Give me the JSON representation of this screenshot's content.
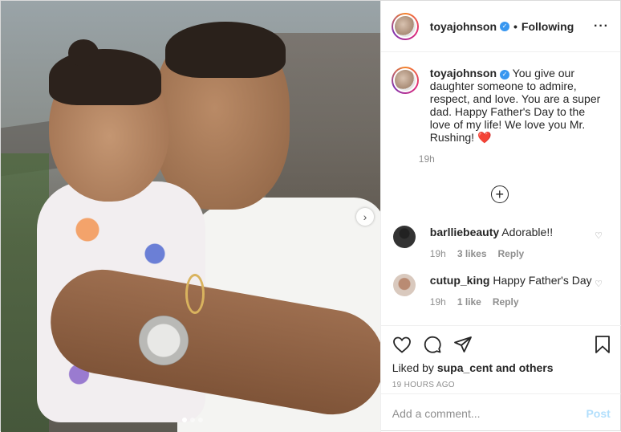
{
  "post": {
    "username": "toyajohnson",
    "follow_status": "Following",
    "more_icon": "ellipsis-icon",
    "photo_slides": {
      "total": 3,
      "active": 1
    }
  },
  "caption": {
    "username": "toyajohnson",
    "text": "You give our daughter someone to admire, respect, and love. You are a super dad. Happy Father's Day to the love of my life! We love you Mr. Rushing!",
    "emoji": "❤️",
    "time": "19h"
  },
  "load_more_symbol": "+",
  "comments": [
    {
      "username": "barlliebeauty",
      "text": "Adorable!!",
      "time": "19h",
      "likes": "3 likes",
      "reply": "Reply"
    },
    {
      "username": "cutup_king",
      "text": "Happy Father's Day",
      "time": "19h",
      "likes": "1 like",
      "reply": "Reply"
    }
  ],
  "liked_by": {
    "prefix": "Liked by",
    "user": "supa_cent",
    "suffix": "and others"
  },
  "timestamp": "19 HOURS AGO",
  "add_comment": {
    "placeholder": "Add a comment...",
    "post_label": "Post"
  },
  "colors": {
    "verified": "#3897f0",
    "post_disabled": "#b2dffc",
    "heart": "#e0203a"
  }
}
